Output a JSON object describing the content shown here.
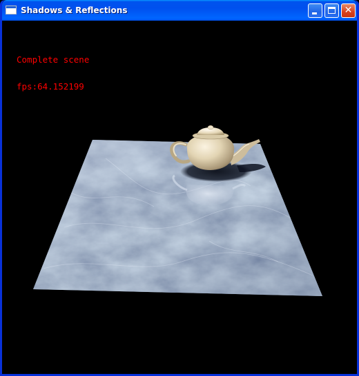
{
  "window": {
    "title": "Shadows & Reflections",
    "icon": "application-window-icon",
    "buttons": {
      "minimize": "minimize-icon",
      "maximize": "maximize-icon",
      "close": "close-icon"
    },
    "close_glyph": "✕"
  },
  "hud": {
    "line1": "Complete scene",
    "line2": "fps:64.152199",
    "color": "#ff0000"
  },
  "scene": {
    "background": "#000000",
    "floor": "marble-plane",
    "object": "teapot",
    "effects": [
      "shadow",
      "reflection"
    ]
  }
}
